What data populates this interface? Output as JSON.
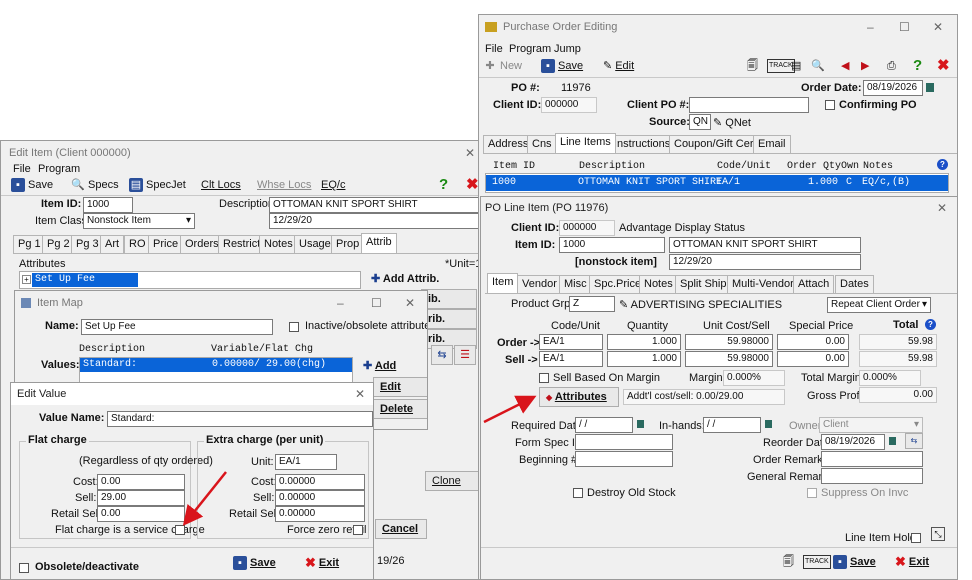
{
  "edit_item": {
    "title": "Edit Item (Client 000000)",
    "menu": [
      "File",
      "Program"
    ],
    "toolbar": {
      "save": "Save",
      "specs": "Specs",
      "specjet": "SpecJet",
      "clt_locs": "Clt Locs",
      "whse_locs": "Whse Locs",
      "eq": "EQ/c"
    },
    "item_id_label": "Item ID:",
    "item_id": "1000",
    "description_label": "Description:",
    "description": "OTTOMAN KNIT SPORT SHIRT",
    "item_class_label": "Item Class:",
    "item_class": "Nonstock Item",
    "date": "12/29/20",
    "tabs": [
      "Pg 1",
      "Pg 2",
      "Pg 3",
      "Art",
      "RO",
      "Price",
      "Orders",
      "Restrict",
      "Notes",
      "Usage",
      "Prop",
      "Attrib"
    ],
    "attributes_label": "Attributes",
    "unit_hint": "*Unit=1",
    "attribute_row": "Set Up Fee",
    "add_attrib": "Add Attrib.",
    "side_buttons": [
      "ib.",
      "rib.",
      "rib."
    ],
    "clone": "Clone",
    "cancel": "Cancel",
    "date_fragment": "19/26"
  },
  "item_map": {
    "title": "Item Map",
    "name_label": "Name:",
    "name": "Set Up Fee",
    "inactive_label": "Inactive/obsolete attribute",
    "values_label": "Values:",
    "col_description": "Description",
    "col_variable": "Variable/Flat Chg",
    "row_description": "Standard:",
    "row_value": "0.00000/   29.00(chg)",
    "add": "Add",
    "edit": "Edit",
    "delete": "Delete"
  },
  "edit_value": {
    "title": "Edit Value",
    "value_name_label": "Value Name:",
    "value_name": "Standard:",
    "flat_title": "Flat charge",
    "flat_note": "(Regardless of qty ordered)",
    "cost_label": "Cost:",
    "flat_cost": "0.00",
    "sell_label": "Sell:",
    "flat_sell": "29.00",
    "retail_label": "Retail Sell:",
    "flat_retail": "0.00",
    "service_label": "Flat charge is a service charge",
    "extra_title": "Extra charge (per unit)",
    "unit_label": "Unit:",
    "unit": "EA/1",
    "extra_cost": "0.00000",
    "extra_sell": "0.00000",
    "extra_retail": "0.00000",
    "force_zero": "Force zero retail",
    "obsolete": "Obsolete/deactivate",
    "save": "Save",
    "exit": "Exit"
  },
  "po": {
    "title": "Purchase Order Editing",
    "menu": [
      "File",
      "Program",
      "Jump"
    ],
    "toolbar": {
      "new": "New",
      "save": "Save",
      "edit": "Edit",
      "track": "TRACK"
    },
    "po_label": "PO #:",
    "po_num": "11976",
    "order_date_label": "Order Date:",
    "order_date": "08/19/2026",
    "client_id_label": "Client ID:",
    "client_id": "000000",
    "client_po_label": "Client PO #:",
    "client_po": "",
    "confirming": "Confirming PO",
    "source_label": "Source:",
    "source": "QN",
    "source_name": "QNet",
    "tabs": [
      "Address",
      "Cns",
      "Line Items",
      "Instructions",
      "Coupon/Gift Cert.",
      "Email"
    ],
    "grid_headers": [
      "Item ID",
      "Description",
      "Code/Unit",
      "Order Qty",
      "Own",
      "Notes"
    ],
    "grid_row": {
      "item_id": "1000",
      "description": "OTTOMAN KNIT SPORT SHIRT",
      "code_unit": "EA/1",
      "qty": "1.000",
      "own": "C",
      "notes": "EQ/c,(B)"
    }
  },
  "line": {
    "title": "PO Line Item (PO      11976)",
    "client_id_label": "Client ID:",
    "client_id": "000000",
    "client_name": "Advantage Display Status",
    "item_id_label": "Item ID:",
    "item_id": "1000",
    "description": "OTTOMAN KNIT SPORT SHIRT",
    "nonstock": "[nonstock item]",
    "date": "12/29/20",
    "tabs": [
      "Item",
      "Vendor",
      "Misc",
      "Spc.Price",
      "Notes",
      "Split Ship",
      "Multi-Vendor",
      "Attach",
      "Dates"
    ],
    "product_grp_label": "Product Grp:",
    "product_grp": "Z",
    "product_grp_name": "ADVERTISING SPECIALITIES",
    "repeat": "Repeat Client Order",
    "headers": {
      "code_unit": "Code/Unit",
      "quantity": "Quantity",
      "unit_cost": "Unit Cost/Sell",
      "special": "Special Price",
      "total": "Total"
    },
    "order_label": "Order ->",
    "sell_label": "Sell ->",
    "order": {
      "unit": "EA/1",
      "qty": "1.000",
      "cost": "59.98000",
      "special": "0.00",
      "total": "59.98"
    },
    "sell": {
      "unit": "EA/1",
      "qty": "1.000",
      "cost": "59.98000",
      "special": "0.00",
      "total": "59.98"
    },
    "sell_based": "Sell Based On Margin",
    "margin_label": "Margin:",
    "margin": "0.000%",
    "total_margin_label": "Total Margin:",
    "total_margin": "0.000%",
    "attributes_btn": "Attributes",
    "addtl": "Addt'l cost/sell: 0.00/29.00",
    "gross_label": "Gross Profit:",
    "gross": "0.00",
    "required_label": "Required Date:",
    "required": "/ /",
    "inhands_label": "In-hands:",
    "inhands": "/ /",
    "owner_label": "Owner:",
    "owner": "Client",
    "formspec_label": "Form Spec ID:",
    "reorder_label": "Reorder Date:",
    "reorder": "08/19/2026",
    "beginning_label": "Beginning #:",
    "order_remarks_label": "Order Remarks:",
    "general_remarks_label": "General Remarks:",
    "destroy": "Destroy Old Stock",
    "suppress": "Suppress On Invc",
    "hold": "Line Item Hold",
    "save": "Save",
    "exit": "Exit"
  },
  "colors": {
    "selection": "#0a64d8",
    "arrow": "#d9141b",
    "help": "#1a8a12",
    "close": "#d8161b"
  }
}
